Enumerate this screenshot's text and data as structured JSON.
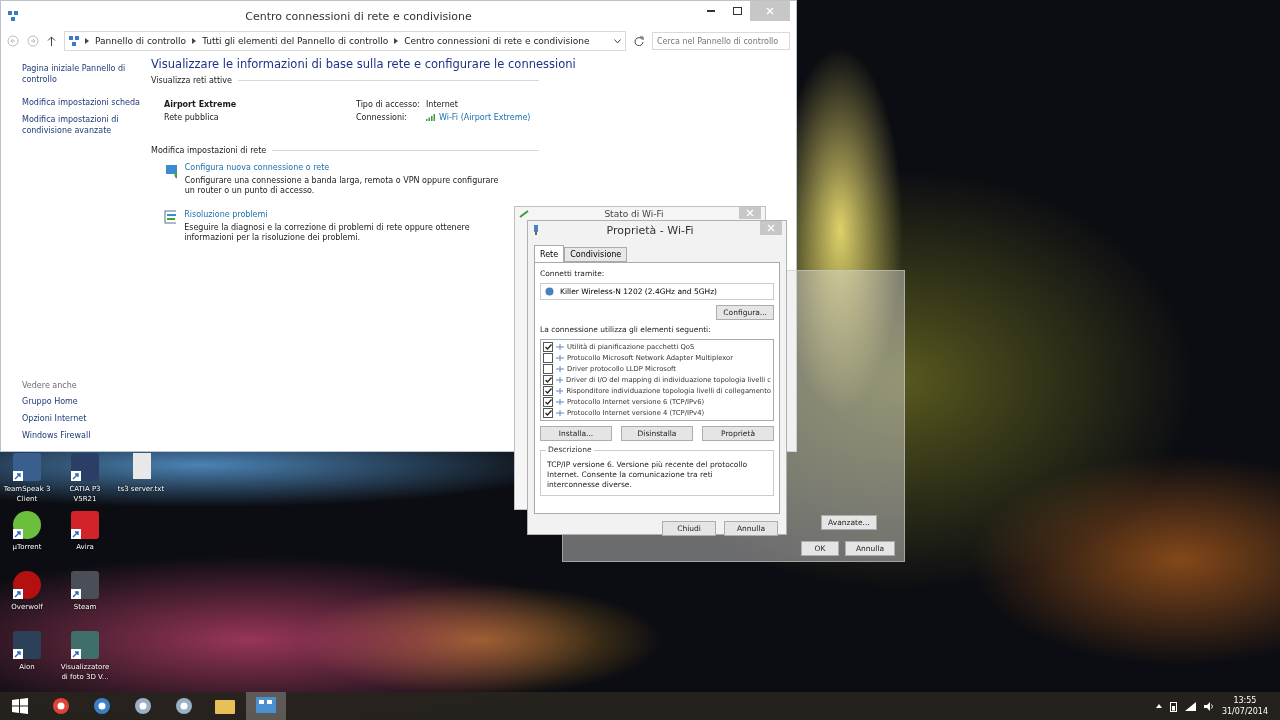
{
  "control_panel": {
    "title": "Centro connessioni di rete e condivisione",
    "breadcrumb": [
      "Pannello di controllo",
      "Tutti gli elementi del Pannello di controllo",
      "Centro connessioni di rete e condivisione"
    ],
    "search": {
      "placeholder": "Cerca nel Pannello di controllo"
    },
    "sidebar": {
      "links": [
        "Pagina iniziale Pannello di controllo",
        "Modifica impostazioni scheda",
        "Modifica impostazioni di condivisione avanzate"
      ],
      "see_also_heading": "Vedere anche",
      "see_also": [
        "Gruppo Home",
        "Opzioni Internet",
        "Windows Firewall"
      ]
    },
    "heading": "Visualizzare le informazioni di base sulla rete e configurare le connessioni",
    "active_networks": {
      "heading": "Visualizza reti attive",
      "name": "Airport Extreme",
      "type": "Rete pubblica",
      "access_label": "Tipo di accesso:",
      "access_value": "Internet",
      "connections_label": "Connessioni:",
      "connection_link": "Wi-Fi (Airport Extreme)"
    },
    "change_settings": {
      "heading": "Modifica impostazioni di rete",
      "tasks": [
        {
          "kind": "setup",
          "link": "Configura nuova connessione o rete",
          "description": "Configurare una connessione a banda larga, remota o VPN oppure configurare un router o un punto di accesso."
        },
        {
          "kind": "troubleshoot",
          "link": "Risoluzione problemi",
          "description": "Eseguire la diagnosi e la correzione di problemi di rete oppure ottenere informazioni per la risoluzione dei problemi."
        }
      ]
    }
  },
  "wifi_status_dialog": {
    "title": "Stato di Wi-Fi"
  },
  "ipv6_dialog": {
    "buttons": [
      {
        "label": "Avanzate...",
        "kind": "side"
      },
      {
        "label": "OK",
        "kind": "footer"
      },
      {
        "label": "Annulla",
        "kind": "footer"
      }
    ]
  },
  "wifi_properties_dialog": {
    "title": "Proprietà - Wi-Fi",
    "tabs": [
      {
        "label": "Rete",
        "selected": true
      },
      {
        "label": "Condivisione",
        "selected": false
      }
    ],
    "connect_label": "Connetti tramite:",
    "adapter": "Killer Wireless-N 1202 (2.4GHz and 5GHz)",
    "configure_button": "Configura...",
    "items_label": "La connessione utilizza gli elementi seguenti:",
    "items": [
      {
        "label": "Utilità di pianificazione pacchetti QoS",
        "checked": true
      },
      {
        "label": "Protocollo Microsoft Network Adapter Multiplexor",
        "checked": false
      },
      {
        "label": "Driver protocollo LLDP Microsoft",
        "checked": false
      },
      {
        "label": "Driver di I/O del mapping di individuazione topologia livelli c",
        "checked": true
      },
      {
        "label": "Risponditore individuazione topologia livelli di collegamento",
        "checked": true
      },
      {
        "label": "Protocollo Internet versione 6 (TCP/IPv6)",
        "checked": true
      },
      {
        "label": "Protocollo Internet versione 4 (TCP/IPv4)",
        "checked": true
      }
    ],
    "buttons": [
      {
        "label": "Installa...",
        "disabled": false
      },
      {
        "label": "Disinstalla",
        "disabled": false
      },
      {
        "label": "Proprietà",
        "disabled": false
      }
    ],
    "description_heading": "Descrizione",
    "description": "TCP/IP versione 6. Versione più recente del protocollo Internet. Consente la comunicazione tra reti interconnesse diverse.",
    "footer_buttons": [
      "Chiudi",
      "Annulla"
    ]
  },
  "desktop_icons": [
    {
      "kind": "teamspeak",
      "label": "TeamSpeak 3 Client"
    },
    {
      "kind": "catia",
      "label": "CATIA P3 V5R21"
    },
    {
      "kind": "text",
      "label": "ts3 server.txt"
    },
    {
      "kind": "utorrent",
      "label": "µTorrent"
    },
    {
      "kind": "avira",
      "label": "Avira"
    },
    {
      "kind": "overwolf",
      "label": "Overwolf"
    },
    {
      "kind": "steam",
      "label": "Steam"
    },
    {
      "kind": "aion",
      "label": "Aion"
    },
    {
      "kind": "photos",
      "label": "Visualizzatore di foto 3D V..."
    }
  ],
  "taskbar": {
    "apps": [
      {
        "kind": "chrome",
        "active": false
      },
      {
        "kind": "mail",
        "active": false
      },
      {
        "kind": "player",
        "active": false
      },
      {
        "kind": "player",
        "active": false
      },
      {
        "kind": "folder",
        "active": false
      },
      {
        "kind": "control-panel",
        "active": true
      }
    ],
    "time": "13:55",
    "date": "31/07/2014"
  }
}
